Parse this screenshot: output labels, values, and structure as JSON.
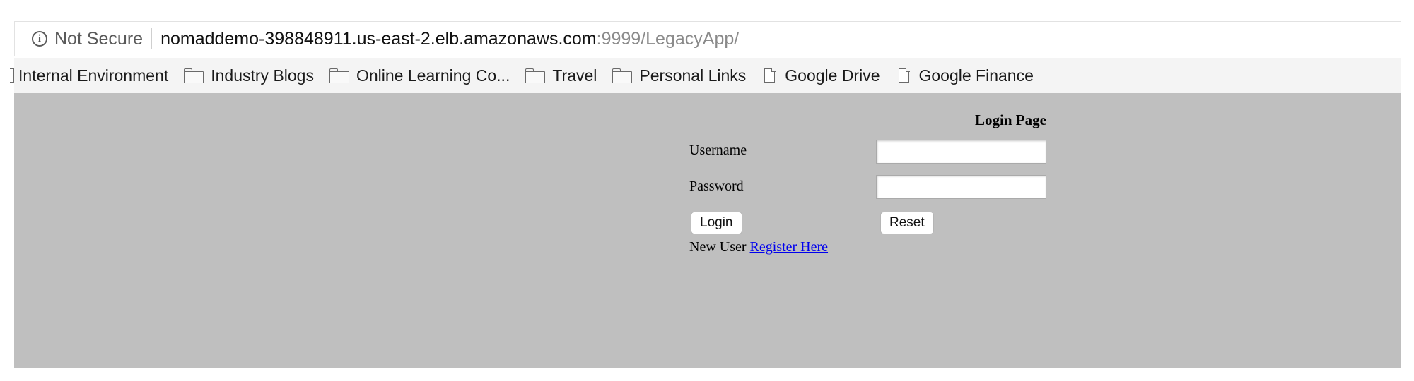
{
  "address_bar": {
    "security_label": "Not Secure",
    "url_host": "nomaddemo-398848911.us-east-2.elb.amazonaws.com",
    "url_path": ":9999/LegacyApp/"
  },
  "bookmarks": [
    {
      "label": "Internal Environment",
      "icon": "page-icon"
    },
    {
      "label": "Industry Blogs",
      "icon": "folder-icon"
    },
    {
      "label": "Online Learning Co...",
      "icon": "folder-icon"
    },
    {
      "label": "Travel",
      "icon": "folder-icon"
    },
    {
      "label": "Personal Links",
      "icon": "folder-icon"
    },
    {
      "label": "Google Drive",
      "icon": "page-icon"
    },
    {
      "label": "Google Finance",
      "icon": "page-icon"
    }
  ],
  "login_form": {
    "title": "Login Page",
    "username_label": "Username",
    "username_value": "",
    "password_label": "Password",
    "password_value": "",
    "login_button": "Login",
    "reset_button": "Reset",
    "new_user_text": "New User",
    "register_link": "Register Here"
  },
  "colors": {
    "page_background": "#bfbfbf",
    "link": "#0000ee",
    "bookmarks_bar": "#f4f4f4"
  }
}
